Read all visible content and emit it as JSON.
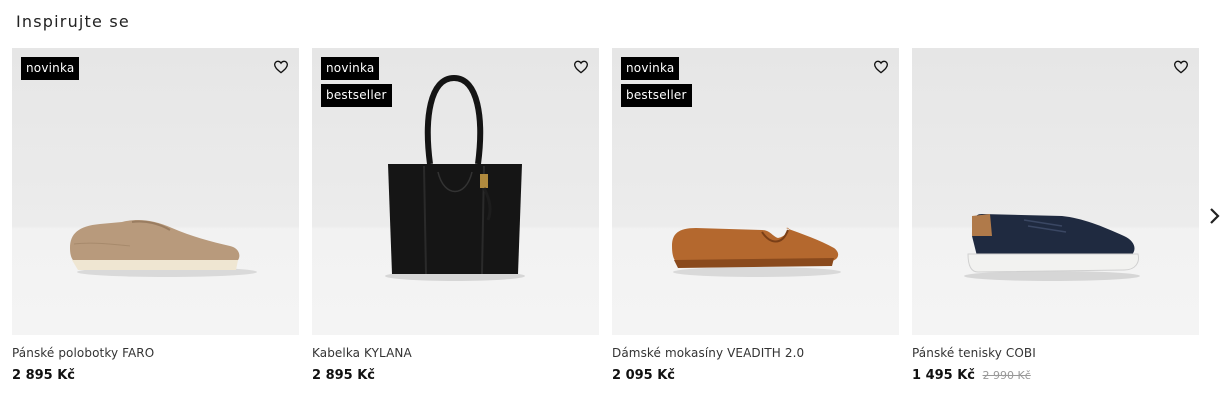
{
  "section": {
    "title": "Inspirujte se"
  },
  "products": [
    {
      "badges": [
        "novinka"
      ],
      "name": "Pánské polobotky FARO",
      "price": "2 895 Kč",
      "old_price": ""
    },
    {
      "badges": [
        "novinka",
        "bestseller"
      ],
      "name": "Kabelka KYLANA",
      "price": "2 895 Kč",
      "old_price": ""
    },
    {
      "badges": [
        "novinka",
        "bestseller"
      ],
      "name": "Dámské mokasíny VEADITH 2.0",
      "price": "2 095 Kč",
      "old_price": ""
    },
    {
      "badges": [],
      "name": "Pánské tenisky COBI",
      "price": "1 495 Kč",
      "old_price": "2 990 Kč"
    }
  ],
  "icons": {
    "wishlist": "heart-icon",
    "next": "chevron-right-icon"
  },
  "colors": {
    "badge_bg": "#000000",
    "badge_text": "#ffffff",
    "old_price": "#999999"
  }
}
